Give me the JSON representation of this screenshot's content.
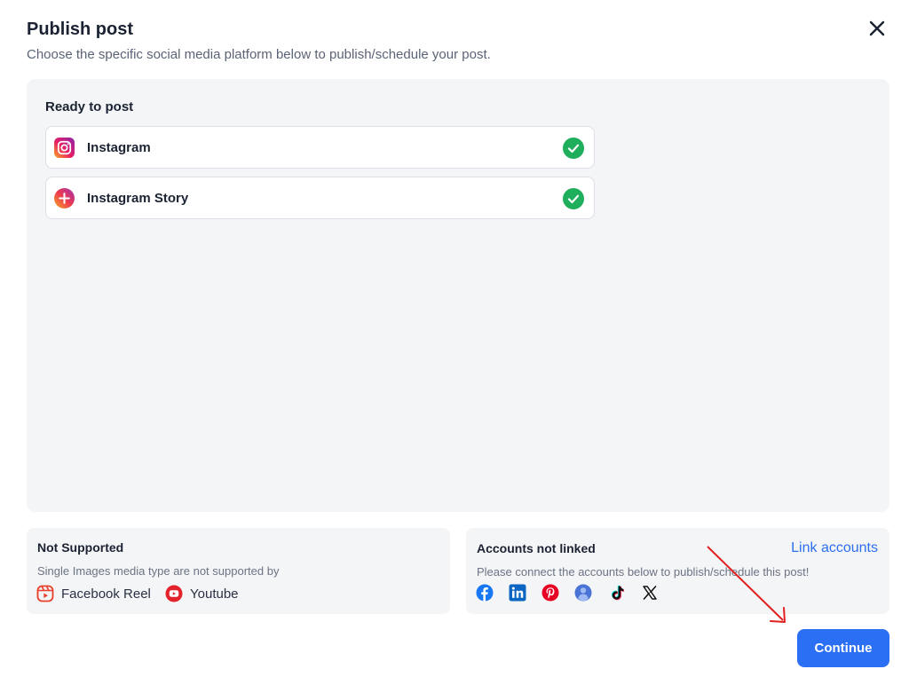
{
  "header": {
    "title": "Publish post",
    "subtitle": "Choose the specific social media platform below to publish/schedule your post.",
    "close_icon": "close-icon"
  },
  "ready": {
    "heading": "Ready to post",
    "platforms": [
      {
        "label": "Instagram",
        "icon": "instagram-icon",
        "status": "checked"
      },
      {
        "label": "Instagram Story",
        "icon": "instagram-story-icon",
        "status": "checked"
      }
    ]
  },
  "not_supported": {
    "title": "Not Supported",
    "description": "Single Images media type are not supported by",
    "items": [
      {
        "label": "Facebook Reel",
        "icon": "facebook-reel-icon"
      },
      {
        "label": "Youtube",
        "icon": "youtube-icon"
      }
    ]
  },
  "not_linked": {
    "title": "Accounts not linked",
    "link_label": "Link accounts",
    "description": "Please connect the accounts below to publish/schedule this post!",
    "accounts": [
      "facebook-icon",
      "linkedin-icon",
      "pinterest-icon",
      "google-business-icon",
      "tiktok-icon",
      "x-icon"
    ]
  },
  "footer": {
    "continue_label": "Continue"
  },
  "colors": {
    "primary": "#2a6ff4",
    "link": "#2c6ff0",
    "success": "#1fae5b",
    "panel_bg": "#f4f5f7",
    "annotation_arrow": "#e02020"
  }
}
